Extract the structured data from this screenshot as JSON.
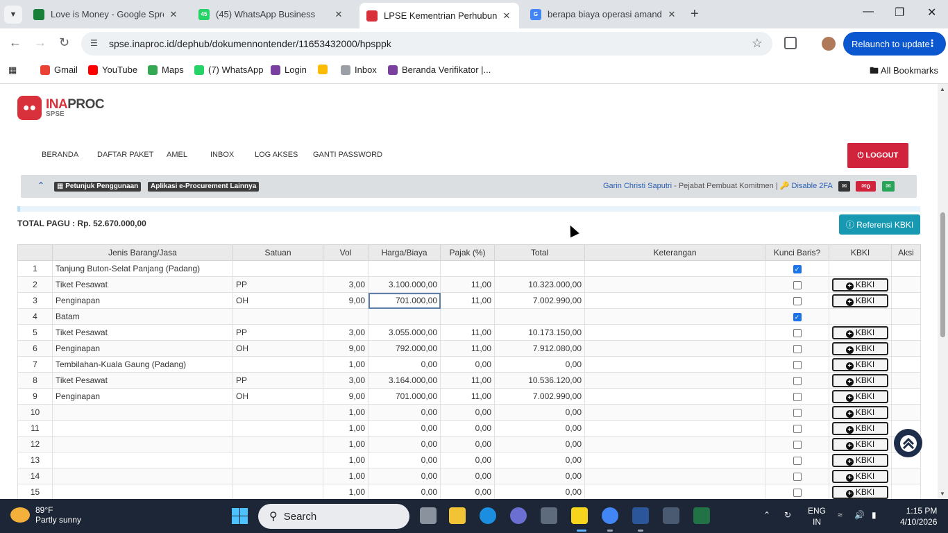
{
  "browser": {
    "tabs": [
      {
        "title": "Love is Money - Google Spread",
        "fav_color": "#188038",
        "fav_text": ""
      },
      {
        "title": "(45) WhatsApp Business",
        "fav_color": "#25d366",
        "fav_text": "45"
      },
      {
        "title": "LPSE Kementrian Perhubungan",
        "fav_color": "#d9313c",
        "fav_text": ""
      },
      {
        "title": "berapa biaya operasi amandel -",
        "fav_color": "#4285f4",
        "fav_text": "G"
      }
    ],
    "url": "spse.inaproc.id/dephub/dokumennontender/11653432000/hpsppk",
    "relaunch_label": "Relaunch to update",
    "bookmarks": [
      {
        "label": "Gmail",
        "color": "#ea4335"
      },
      {
        "label": "YouTube",
        "color": "#ff0000"
      },
      {
        "label": "Maps",
        "color": "#34a853"
      },
      {
        "label": "(7) WhatsApp",
        "color": "#25d366"
      },
      {
        "label": "Login",
        "color": "#7b3fa0"
      },
      {
        "label": "",
        "color": "#fbbc05"
      },
      {
        "label": "Inbox",
        "color": "#9aa0a6"
      },
      {
        "label": "Beranda Verifikator |...",
        "color": "#7b3fa0"
      }
    ],
    "all_bookmarks_label": "All Bookmarks"
  },
  "site": {
    "logo_main": "INA",
    "logo_bold": "PROC",
    "logo_sub": "SPSE",
    "menu": [
      "BERANDA",
      "DAFTAR PAKET",
      "AMEL",
      "INBOX",
      "LOG AKSES",
      "GANTI PASSWORD"
    ],
    "logout_label": "LOGOUT",
    "info_labels": [
      "Petunjuk Penggunaan",
      "Aplikasi e-Procurement Lainnya"
    ],
    "user_name": "Garin Christi Saputri",
    "user_role": " - Pejabat Pembuat Komitmen | ",
    "twofa_label": "Disable 2FA",
    "mail_count": "0"
  },
  "main": {
    "total_pagu": "TOTAL PAGU : Rp. 52.670.000,00",
    "ref_button": "Referensi KBKI",
    "columns": [
      "",
      "Jenis Barang/Jasa",
      "Satuan",
      "Vol",
      "Harga/Biaya",
      "Pajak (%)",
      "Total",
      "Keterangan",
      "Kunci Baris?",
      "KBKI",
      "Aksi"
    ],
    "kbki_label": "KBKI",
    "rows": [
      {
        "no": "1",
        "jenis": "Tanjung Buton-Selat Panjang (Padang)",
        "satuan": "",
        "vol": "",
        "harga": "",
        "pajak": "",
        "total": "",
        "ket": "",
        "kunci": true,
        "kbki": false
      },
      {
        "no": "2",
        "jenis": "Tiket Pesawat",
        "satuan": "PP",
        "vol": "3,00",
        "harga": "3.100.000,00",
        "pajak": "11,00",
        "total": "10.323.000,00",
        "ket": "",
        "kunci": false,
        "kbki": true
      },
      {
        "no": "3",
        "jenis": "Penginapan",
        "satuan": "OH",
        "vol": "9,00",
        "harga": "701.000,00",
        "pajak": "11,00",
        "total": "7.002.990,00",
        "ket": "",
        "kunci": false,
        "kbki": true
      },
      {
        "no": "4",
        "jenis": "Batam",
        "satuan": "",
        "vol": "",
        "harga": "",
        "pajak": "",
        "total": "",
        "ket": "",
        "kunci": true,
        "kbki": false
      },
      {
        "no": "5",
        "jenis": "Tiket Pesawat",
        "satuan": "PP",
        "vol": "3,00",
        "harga": "3.055.000,00",
        "pajak": "11,00",
        "total": "10.173.150,00",
        "ket": "",
        "kunci": false,
        "kbki": true
      },
      {
        "no": "6",
        "jenis": "Penginapan",
        "satuan": "OH",
        "vol": "9,00",
        "harga": "792.000,00",
        "pajak": "11,00",
        "total": "7.912.080,00",
        "ket": "",
        "kunci": false,
        "kbki": true
      },
      {
        "no": "7",
        "jenis": "Tembilahan-Kuala Gaung (Padang)",
        "satuan": "",
        "vol": "1,00",
        "harga": "0,00",
        "pajak": "0,00",
        "total": "0,00",
        "ket": "",
        "kunci": false,
        "kbki": true
      },
      {
        "no": "8",
        "jenis": "Tiket Pesawat",
        "satuan": "PP",
        "vol": "3,00",
        "harga": "3.164.000,00",
        "pajak": "11,00",
        "total": "10.536.120,00",
        "ket": "",
        "kunci": false,
        "kbki": true
      },
      {
        "no": "9",
        "jenis": "Penginapan",
        "satuan": "OH",
        "vol": "9,00",
        "harga": "701.000,00",
        "pajak": "11,00",
        "total": "7.002.990,00",
        "ket": "",
        "kunci": false,
        "kbki": true
      },
      {
        "no": "10",
        "jenis": "",
        "satuan": "",
        "vol": "1,00",
        "harga": "0,00",
        "pajak": "0,00",
        "total": "0,00",
        "ket": "",
        "kunci": false,
        "kbki": true
      },
      {
        "no": "11",
        "jenis": "",
        "satuan": "",
        "vol": "1,00",
        "harga": "0,00",
        "pajak": "0,00",
        "total": "0,00",
        "ket": "",
        "kunci": false,
        "kbki": true
      },
      {
        "no": "12",
        "jenis": "",
        "satuan": "",
        "vol": "1,00",
        "harga": "0,00",
        "pajak": "0,00",
        "total": "0,00",
        "ket": "",
        "kunci": false,
        "kbki": true
      },
      {
        "no": "13",
        "jenis": "",
        "satuan": "",
        "vol": "1,00",
        "harga": "0,00",
        "pajak": "0,00",
        "total": "0,00",
        "ket": "",
        "kunci": false,
        "kbki": true
      },
      {
        "no": "14",
        "jenis": "",
        "satuan": "",
        "vol": "1,00",
        "harga": "0,00",
        "pajak": "0,00",
        "total": "0,00",
        "ket": "",
        "kunci": false,
        "kbki": true
      },
      {
        "no": "15",
        "jenis": "",
        "satuan": "",
        "vol": "1,00",
        "harga": "0,00",
        "pajak": "0,00",
        "total": "0,00",
        "ket": "",
        "kunci": false,
        "kbki": true
      }
    ]
  },
  "taskbar": {
    "temp": "89°F",
    "weather": "Partly sunny",
    "search_placeholder": "Search",
    "lang1": "ENG",
    "lang2": "IN",
    "time": "1:15 PM",
    "date": "4/10/2026"
  }
}
